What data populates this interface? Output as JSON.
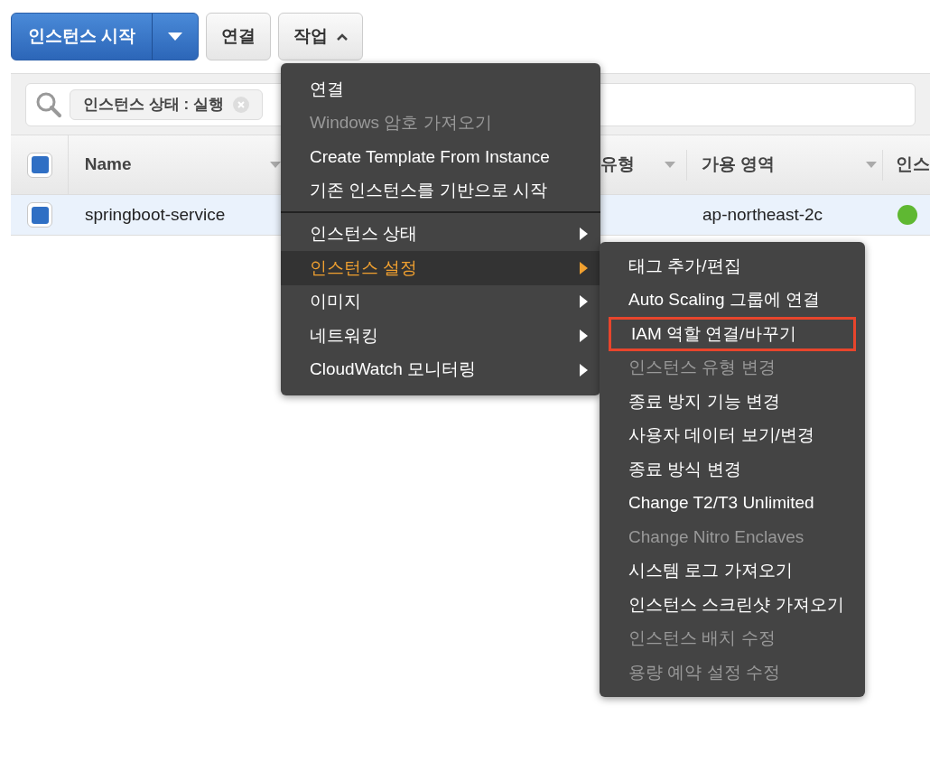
{
  "toolbar": {
    "launch_button": "인스턴스 시작",
    "connect_button": "연결",
    "actions_button": {
      "label": "작업",
      "expanded": true
    }
  },
  "filter": {
    "chip": "인스턴스 상태 : 실행"
  },
  "table": {
    "header_checked": true,
    "columns": [
      {
        "label": "Name"
      },
      {
        "label": "유형"
      },
      {
        "label": "가용 영역"
      },
      {
        "label": "인스"
      }
    ],
    "rows": [
      {
        "checked": true,
        "name": "springboot-service",
        "zone": "ap-northeast-2c",
        "color": "#5fb832"
      }
    ]
  },
  "actions_menu": {
    "groups": [
      [
        {
          "label": "연결",
          "disabled": false,
          "submenu": false,
          "selected": false
        },
        {
          "label": "Windows 암호 가져오기",
          "disabled": true,
          "submenu": false,
          "selected": false
        },
        {
          "label": "Create Template From Instance",
          "disabled": false,
          "submenu": false,
          "selected": false
        },
        {
          "label": "기존 인스턴스를 기반으로 시작",
          "disabled": false,
          "submenu": false,
          "selected": false
        }
      ],
      [
        {
          "label": "인스턴스 상태",
          "disabled": false,
          "submenu": true,
          "selected": false
        },
        {
          "label": "인스턴스 설정",
          "disabled": false,
          "submenu": true,
          "selected": true
        },
        {
          "label": "이미지",
          "disabled": false,
          "submenu": true,
          "selected": false
        },
        {
          "label": "네트워킹",
          "disabled": false,
          "submenu": true,
          "selected": false
        },
        {
          "label": "CloudWatch 모니터링",
          "disabled": false,
          "submenu": true,
          "selected": false
        }
      ]
    ]
  },
  "settings_submenu": {
    "items": [
      {
        "label": "태그 추가/편집",
        "disabled": false,
        "highlighted": false
      },
      {
        "label": "Auto Scaling 그룹에 연결",
        "disabled": false,
        "highlighted": false
      },
      {
        "label": "IAM 역할 연결/바꾸기",
        "disabled": false,
        "highlighted": true
      },
      {
        "label": "인스턴스 유형 변경",
        "disabled": true,
        "highlighted": false
      },
      {
        "label": "종료 방지 기능 변경",
        "disabled": false,
        "highlighted": false
      },
      {
        "label": "사용자 데이터 보기/변경",
        "disabled": false,
        "highlighted": false
      },
      {
        "label": "종료 방식 변경",
        "disabled": false,
        "highlighted": false
      },
      {
        "label": "Change T2/T3 Unlimited",
        "disabled": false,
        "highlighted": false
      },
      {
        "label": "Change Nitro Enclaves",
        "disabled": true,
        "highlighted": false
      },
      {
        "label": "시스템 로그 가져오기",
        "disabled": false,
        "highlighted": false
      },
      {
        "label": "인스턴스 스크린샷 가져오기",
        "disabled": false,
        "highlighted": false
      },
      {
        "label": "인스턴스 배치 수정",
        "disabled": true,
        "highlighted": false
      },
      {
        "label": "용량 예약 설정 수정",
        "disabled": true,
        "highlighted": false
      }
    ]
  }
}
